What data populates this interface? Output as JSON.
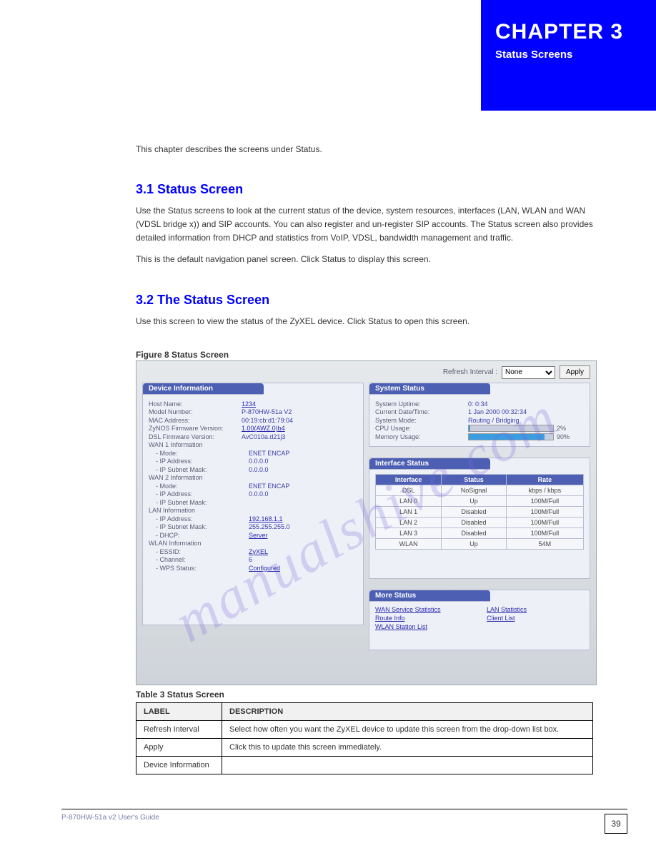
{
  "chapter": {
    "number_label": "CHAPTER  3",
    "title": "Status Screens"
  },
  "intro": "This chapter describes the screens under Status.",
  "sec31": {
    "heading": "3.1  Status Screen",
    "p1": "Use the Status screens to look at the current status of the device, system resources, interfaces (LAN, WLAN and WAN (VDSL bridge x)) and SIP accounts. You can also register and un-register SIP accounts. The Status screen also provides detailed information from DHCP and statistics from VoIP, VDSL, bandwidth management and traffic.",
    "p2": "This is the default navigation panel screen. Click Status to display this screen."
  },
  "sec32": {
    "heading": "3.2  The Status Screen",
    "p1": "Use this screen to view the status of the ZyXEL device. Click Status to open this screen."
  },
  "figure_label": "Figure 8   Status Screen",
  "refresh": {
    "label": "Refresh Interval :",
    "selected": "None",
    "apply": "Apply"
  },
  "panels": {
    "device": {
      "title": "Device Information",
      "rows": [
        {
          "k": "Host Name:",
          "v": "1234",
          "link": true
        },
        {
          "k": "Model Number:",
          "v": "P-870HW-51a V2"
        },
        {
          "k": "MAC Address:",
          "v": "00:19:cb:d1:79:04"
        },
        {
          "k": "ZyNOS Firmware Version:",
          "v": "1.00(AWZ.0)b4",
          "link": true
        },
        {
          "k": "DSL Firmware Version:",
          "v": "AvC010a.d21j3"
        }
      ],
      "wan1_header": "WAN 1 Information",
      "wan1": [
        {
          "k": "- Mode:",
          "v": "ENET ENCAP"
        },
        {
          "k": "- IP Address:",
          "v": "0.0.0.0"
        },
        {
          "k": "- IP Subnet Mask:",
          "v": "0.0.0.0"
        }
      ],
      "wan2_header": "WAN 2 Information",
      "wan2": [
        {
          "k": "- Mode:",
          "v": "ENET ENCAP"
        },
        {
          "k": "- IP Address:",
          "v": "0.0.0.0"
        },
        {
          "k": "- IP Subnet Mask:",
          "v": ""
        }
      ],
      "lan_header": "LAN Information",
      "lan": [
        {
          "k": "- IP Address:",
          "v": "192.168.1.1",
          "link": true
        },
        {
          "k": "- IP Subnet Mask:",
          "v": "255.255.255.0"
        },
        {
          "k": "- DHCP:",
          "v": "Server",
          "link": true
        }
      ],
      "wlan_header": "WLAN Information",
      "wlan": [
        {
          "k": "- ESSID:",
          "v": "ZyXEL",
          "link": true
        },
        {
          "k": "- Channel:",
          "v": "6"
        },
        {
          "k": "- WPS Status:",
          "v": "Configured",
          "link": true
        }
      ]
    },
    "system": {
      "title": "System Status",
      "rows": [
        {
          "k": "System Uptime:",
          "v": "0: 0:34"
        },
        {
          "k": "Current Date/Time:",
          "v": "1 Jan 2000 00:32:34"
        },
        {
          "k": "System Mode:",
          "v": "Routing / Bridging"
        }
      ],
      "cpu_label": "CPU Usage:",
      "cpu_pct": 2,
      "mem_label": "Memory Usage:",
      "mem_pct": 90
    },
    "iface": {
      "title": "Interface Status",
      "headers": [
        "Interface",
        "Status",
        "Rate"
      ],
      "rows": [
        {
          "i": "DSL",
          "s": "NoSignal",
          "r": "kbps / kbps"
        },
        {
          "i": "LAN 0",
          "s": "Up",
          "r": "100M/Full"
        },
        {
          "i": "LAN 1",
          "s": "Disabled",
          "r": "100M/Full"
        },
        {
          "i": "LAN 2",
          "s": "Disabled",
          "r": "100M/Full"
        },
        {
          "i": "LAN 3",
          "s": "Disabled",
          "r": "100M/Full"
        },
        {
          "i": "WLAN",
          "s": "Up",
          "r": "54M"
        }
      ]
    },
    "more": {
      "title": "More Status",
      "links": [
        "WAN Service Statistics",
        "LAN Statistics",
        "Route Info",
        "Client List",
        "WLAN Station List"
      ]
    }
  },
  "table_label": "Table 3   Status Screen",
  "desc_table": {
    "headers": [
      "LABEL",
      "DESCRIPTION"
    ],
    "rows": [
      {
        "label": "Refresh Interval",
        "desc": "Select how often you want the ZyXEL device to update this screen from the drop-down list box."
      },
      {
        "label": "Apply",
        "desc": "Click this to update this screen immediately."
      },
      {
        "label": "Device Information",
        "desc": ""
      }
    ]
  },
  "footer": {
    "guide": "P-870HW-51a v2 User's Guide",
    "page": "39"
  },
  "watermark": "manualshive.com"
}
